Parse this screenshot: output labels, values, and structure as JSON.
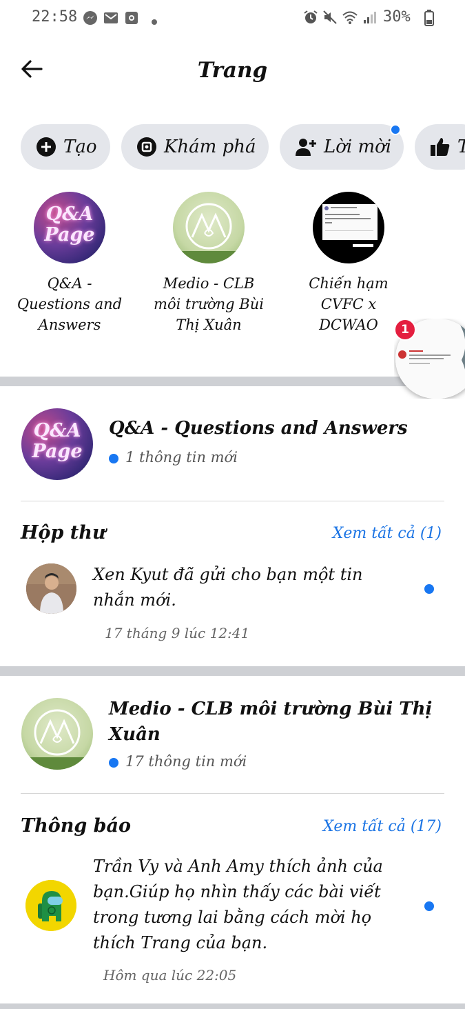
{
  "status_bar": {
    "time": "22:58",
    "battery": "30%",
    "left_icons": [
      "messenger-icon",
      "gmail-icon",
      "camera-icon",
      "dot-icon"
    ],
    "right_icons": [
      "alarm-icon",
      "mute-icon",
      "wifi-icon",
      "signal-icon",
      "battery-icon"
    ]
  },
  "header": {
    "title": "Trang",
    "back_icon": "back-arrow-icon"
  },
  "chips": [
    {
      "label": "Tạo",
      "icon": "plus-circle-icon"
    },
    {
      "label": "Khám phá",
      "icon": "compass-icon"
    },
    {
      "label": "Lời mời",
      "icon": "add-person-icon",
      "has_badge": true
    },
    {
      "label": "T",
      "icon": "thumbs-up-icon"
    }
  ],
  "pages_carousel": [
    {
      "name": "Q&A - Questions and Answers",
      "avatar_text": "Q&A Page"
    },
    {
      "name": "Medio - CLB môi trường Bùi Thị Xuân"
    },
    {
      "name": "Chiến hạm CVFC x DCWAO"
    }
  ],
  "chat_head": {
    "badge": "1"
  },
  "sections": [
    {
      "page_name": "Q&A - Questions and Answers",
      "new_info": "1 thông tin mới",
      "list_title": "Hộp thư",
      "see_all": "Xem tất cả (1)",
      "item": {
        "text": "Xen Kyut đã gửi cho bạn một tin nhắn mới.",
        "time": "17 tháng 9 lúc 12:41"
      }
    },
    {
      "page_name": "Medio - CLB môi trường Bùi Thị Xuân",
      "new_info": "17 thông tin mới",
      "list_title": "Thông báo",
      "see_all": "Xem tất cả (17)",
      "item": {
        "text": "Trần Vy và Anh Amy thích ảnh của bạn.Giúp họ nhìn thấy các bài viết trong tương lai bằng cách mời họ thích Trang của bạn.",
        "time": "Hôm qua lúc 22:05"
      }
    }
  ],
  "colors": {
    "accent": "#1b74e4",
    "dot": "#1877f2",
    "chip_bg": "#e4e6eb",
    "divider": "#ced0d4",
    "badge": "#e41e3f"
  }
}
